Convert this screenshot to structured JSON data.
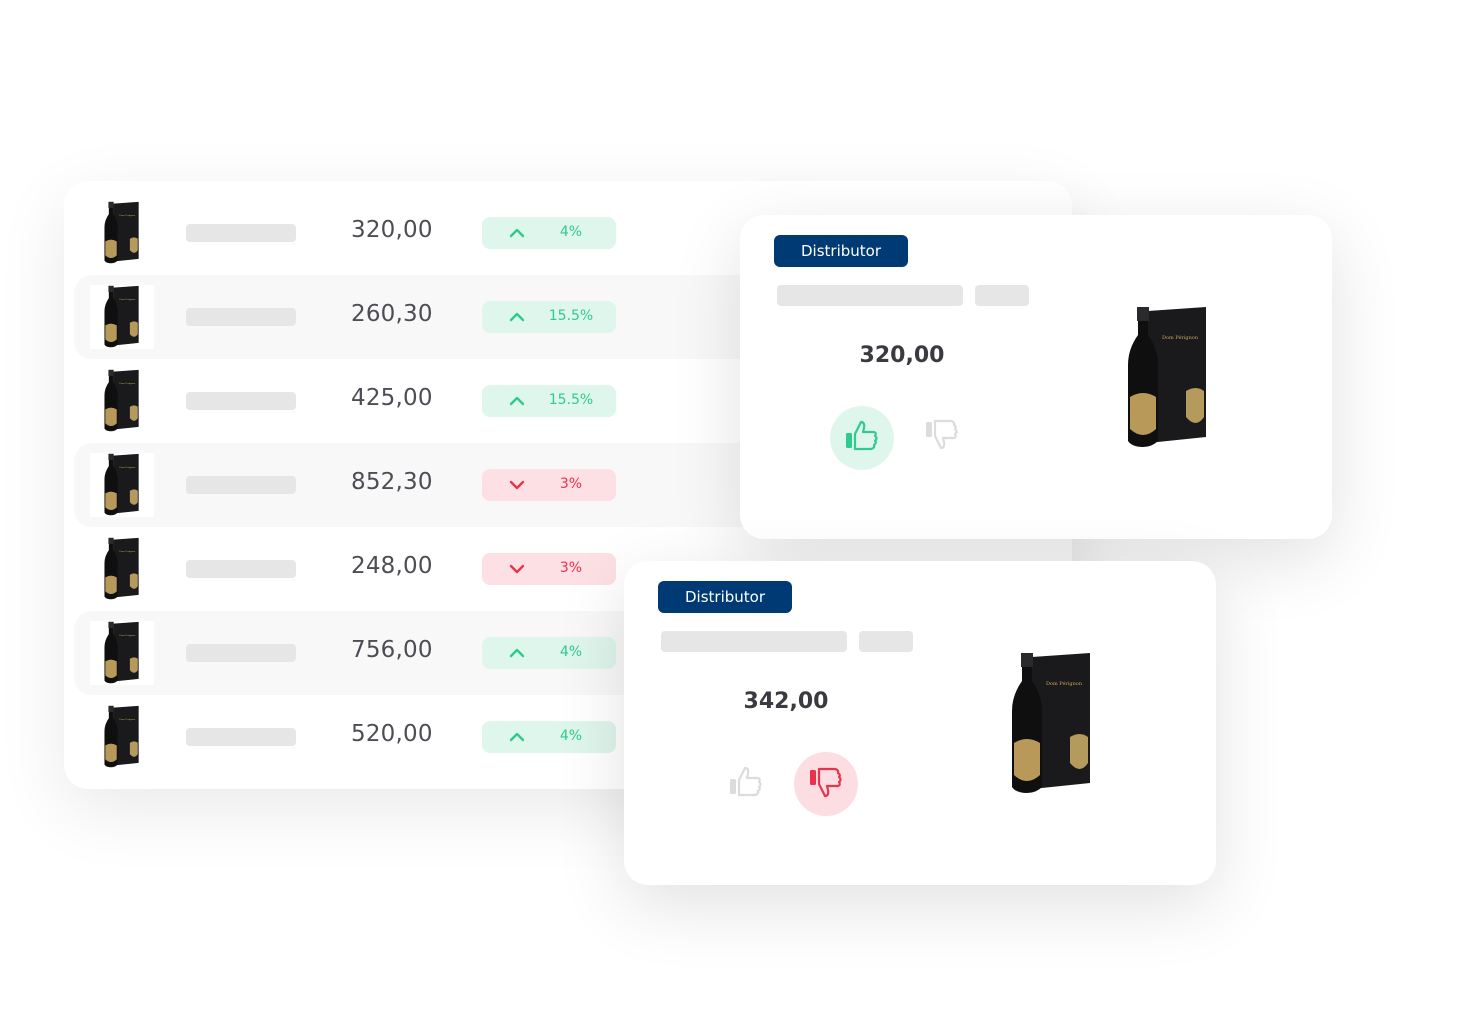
{
  "colors": {
    "up": "#2fcb8e",
    "up_bg": "#dff6ec",
    "down": "#e8334d",
    "down_bg": "#fde0e4",
    "brand": "#003a75"
  },
  "table": {
    "rows": [
      {
        "price": "320,00",
        "trend": "up",
        "change": "4%"
      },
      {
        "price": "260,30",
        "trend": "up",
        "change": "15.5%"
      },
      {
        "price": "425,00",
        "trend": "up",
        "change": "15.5%"
      },
      {
        "price": "852,30",
        "trend": "down",
        "change": "3%"
      },
      {
        "price": "248,00",
        "trend": "down",
        "change": "3%"
      },
      {
        "price": "756,00",
        "trend": "up",
        "change": "4%"
      },
      {
        "price": "520,00",
        "trend": "up",
        "change": "4%"
      }
    ]
  },
  "cards": [
    {
      "badge": "Distributor",
      "price": "320,00",
      "vote": "thumbs-up",
      "icons": [
        "thumbs-up-icon",
        "thumbs-down-icon"
      ]
    },
    {
      "badge": "Distributor",
      "price": "342,00",
      "vote": "thumbs-down",
      "icons": [
        "thumbs-up-icon",
        "thumbs-down-icon"
      ]
    }
  ]
}
